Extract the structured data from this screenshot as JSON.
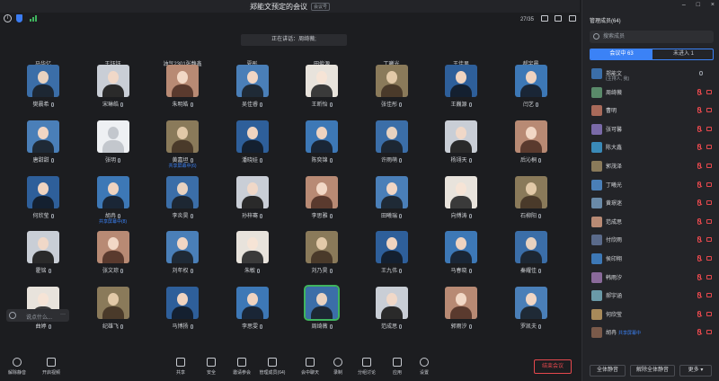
{
  "window": {
    "title": "郑能文预定的会议",
    "tag": "会议号"
  },
  "topbar": {
    "count": "27/35"
  },
  "speaking": "正在讲话：周绮薇;",
  "top_names": [
    "马华亿",
    "王钰钰",
    "油气2301张静鑫",
    "夏彤",
    "田俊源",
    "丁曦光",
    "王佳男",
    "郝宇晨"
  ],
  "grid": [
    [
      "樊晨希",
      "宋琳皓",
      "朱明皓",
      "吴佳睿",
      "王昕怡",
      "张佳彤",
      "王巍源",
      "闫艺"
    ],
    [
      "唐甜甜",
      "张明",
      "黄嘉坦",
      "潘晓娃",
      "陈奕锦",
      "许雨萌",
      "杨翊天",
      "后沁桐"
    ],
    [
      "何欣莹",
      "胡冉",
      "李炎昊",
      "孙梓骞",
      "李思雅",
      "田曦瑞",
      "向傅涛",
      "石柳阳"
    ],
    [
      "霍铭",
      "张文琮",
      "刘年权",
      "朱敏",
      "刘乃昊",
      "王九伟",
      "马春晓",
      "秦耀佳"
    ],
    [
      "曲婷",
      "纪雄飞",
      "马博扬",
      "李思雯",
      "周绮薇",
      "范成思",
      "郭雨汐",
      "罗凯夫"
    ]
  ],
  "grid_subs": {
    "1-2": "共享屏幕中(6)",
    "2-1": "共享屏幕中(8)"
  },
  "chat": {
    "placeholder": "说点什么...",
    "dots": "···"
  },
  "toolbar": {
    "left": [
      "解除静音",
      "开启视频"
    ],
    "center": [
      "共享",
      "安全",
      "邀请参会",
      "管理成员(64)",
      "会中聊天",
      "录制",
      "分组讨论",
      "应用",
      "设置"
    ],
    "end": "结束会议"
  },
  "panel": {
    "title": "管理成员(64)",
    "search_placeholder": "搜索成员",
    "tabs": [
      "会议中 63",
      "未进入 1"
    ],
    "members": [
      {
        "name": "郑能文",
        "note": "(主持人, 我)"
      },
      {
        "name": "周绮薇",
        "note": ""
      },
      {
        "name": "曹明",
        "note": ""
      },
      {
        "name": "张可馨",
        "note": ""
      },
      {
        "name": "陈大鑫",
        "note": ""
      },
      {
        "name": "郭茂泽",
        "note": ""
      },
      {
        "name": "丁曦光",
        "note": ""
      },
      {
        "name": "黄璟迷",
        "note": ""
      },
      {
        "name": "范成思",
        "note": ""
      },
      {
        "name": "付欣雨",
        "note": ""
      },
      {
        "name": "侯印翔",
        "note": ""
      },
      {
        "name": "韩雨汐",
        "note": ""
      },
      {
        "name": "郝宇涵",
        "note": ""
      },
      {
        "name": "何欣莹",
        "note": ""
      },
      {
        "name": "胡冉",
        "note": "共享屏幕中"
      }
    ],
    "footer": [
      "全体静音",
      "解除全体静音",
      "更多"
    ]
  },
  "colors": {
    "accent": "#3b82f6",
    "danger": "#e5484d",
    "active": "#3fb45e"
  }
}
